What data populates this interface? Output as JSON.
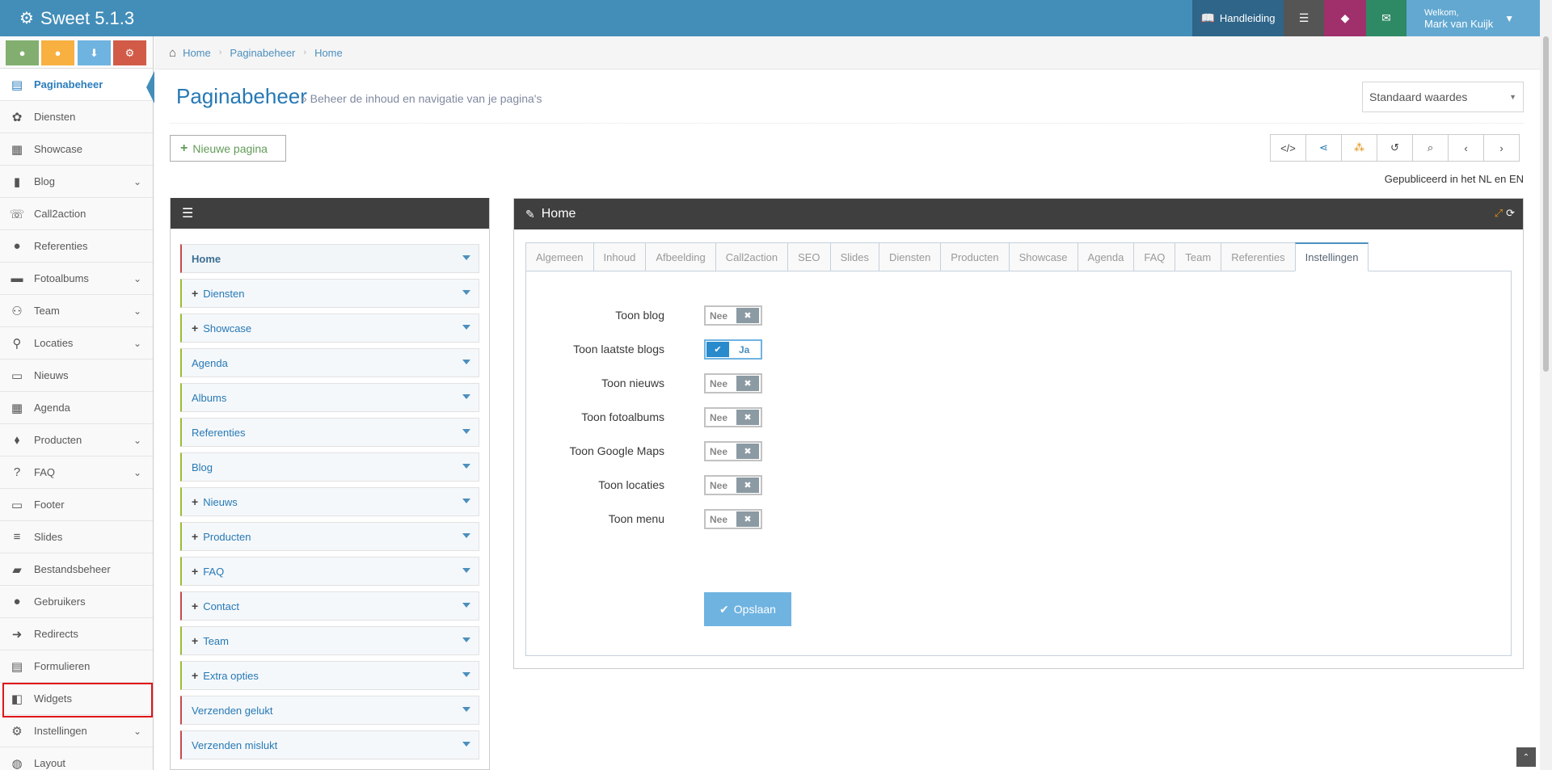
{
  "app": {
    "title": "Sweet 5.1.3"
  },
  "topbar": {
    "manual_label": "Handleiding",
    "welcome_small": "Welkom,",
    "user_name": "Mark van Kuijk"
  },
  "sidebar": {
    "items": [
      {
        "label": "Paginabeheer",
        "icon": "pages-icon",
        "active": true,
        "has_children": false
      },
      {
        "label": "Diensten",
        "icon": "services-icon",
        "has_children": false
      },
      {
        "label": "Showcase",
        "icon": "grid-icon",
        "has_children": false
      },
      {
        "label": "Blog",
        "icon": "file-icon",
        "has_children": true
      },
      {
        "label": "Call2action",
        "icon": "phone-icon",
        "has_children": false
      },
      {
        "label": "Referenties",
        "icon": "comments-icon",
        "has_children": false
      },
      {
        "label": "Fotoalbums",
        "icon": "folder-icon",
        "has_children": true
      },
      {
        "label": "Team",
        "icon": "team-icon",
        "has_children": true
      },
      {
        "label": "Locaties",
        "icon": "map-marker-icon",
        "has_children": true
      },
      {
        "label": "Nieuws",
        "icon": "newspaper-icon",
        "has_children": false
      },
      {
        "label": "Agenda",
        "icon": "calendar-icon",
        "has_children": false
      },
      {
        "label": "Producten",
        "icon": "tags-icon",
        "has_children": true
      },
      {
        "label": "FAQ",
        "icon": "question-icon",
        "has_children": true
      },
      {
        "label": "Footer",
        "icon": "footer-icon",
        "has_children": false
      },
      {
        "label": "Slides",
        "icon": "sliders-icon",
        "has_children": false
      },
      {
        "label": "Bestandsbeheer",
        "icon": "folder-open-icon",
        "has_children": false
      },
      {
        "label": "Gebruikers",
        "icon": "user-icon",
        "has_children": false
      },
      {
        "label": "Redirects",
        "icon": "redirect-icon",
        "has_children": false
      },
      {
        "label": "Formulieren",
        "icon": "form-icon",
        "has_children": false
      },
      {
        "label": "Widgets",
        "icon": "widget-icon",
        "has_children": false
      },
      {
        "label": "Instellingen",
        "icon": "gear-icon",
        "has_children": true
      },
      {
        "label": "Layout",
        "icon": "palette-icon",
        "has_children": false
      }
    ]
  },
  "breadcrumb": [
    "Home",
    "Paginabeheer",
    "Home"
  ],
  "page": {
    "title": "Paginabeheer",
    "subtitle": "» Beheer de inhoud en navigatie van je pagina's",
    "select_value": "Standaard waardes",
    "new_page_label": "Nieuwe pagina",
    "published_text": "Gepubliceerd in het NL en EN"
  },
  "tree": {
    "items": [
      {
        "label": "Home",
        "color": "red",
        "plus": false,
        "bold": true
      },
      {
        "label": "Diensten",
        "color": "green",
        "plus": true
      },
      {
        "label": "Showcase",
        "color": "green",
        "plus": true
      },
      {
        "label": "Agenda",
        "color": "green",
        "plus": false
      },
      {
        "label": "Albums",
        "color": "green",
        "plus": false
      },
      {
        "label": "Referenties",
        "color": "green",
        "plus": false
      },
      {
        "label": "Blog",
        "color": "green",
        "plus": false
      },
      {
        "label": "Nieuws",
        "color": "green",
        "plus": true
      },
      {
        "label": "Producten",
        "color": "green",
        "plus": true
      },
      {
        "label": "FAQ",
        "color": "green",
        "plus": true
      },
      {
        "label": "Contact",
        "color": "red",
        "plus": true
      },
      {
        "label": "Team",
        "color": "green",
        "plus": true
      },
      {
        "label": "Extra opties",
        "color": "green",
        "plus": true
      },
      {
        "label": "Verzenden gelukt",
        "color": "red",
        "plus": false
      },
      {
        "label": "Verzenden mislukt",
        "color": "red",
        "plus": false
      }
    ]
  },
  "editor": {
    "title": "Home",
    "tabs": [
      "Algemeen",
      "Inhoud",
      "Afbeelding",
      "Call2action",
      "SEO",
      "Slides",
      "Diensten",
      "Producten",
      "Showcase",
      "Agenda",
      "FAQ",
      "Team",
      "Referenties",
      "Instellingen"
    ],
    "active_tab": "Instellingen",
    "settings": [
      {
        "label": "Toon blog",
        "value": "Nee",
        "on": false
      },
      {
        "label": "Toon laatste blogs",
        "value": "Ja",
        "on": true
      },
      {
        "label": "Toon nieuws",
        "value": "Nee",
        "on": false
      },
      {
        "label": "Toon fotoalbums",
        "value": "Nee",
        "on": false
      },
      {
        "label": "Toon Google Maps",
        "value": "Nee",
        "on": false
      },
      {
        "label": "Toon locaties",
        "value": "Nee",
        "on": false
      },
      {
        "label": "Toon menu",
        "value": "Nee",
        "on": false
      }
    ],
    "save_label": "Opslaan"
  },
  "colors": {
    "topbar": "#438eb9",
    "accent": "#2679b5",
    "panel_head": "#3f3f3f",
    "highlight": "#e0151b"
  }
}
